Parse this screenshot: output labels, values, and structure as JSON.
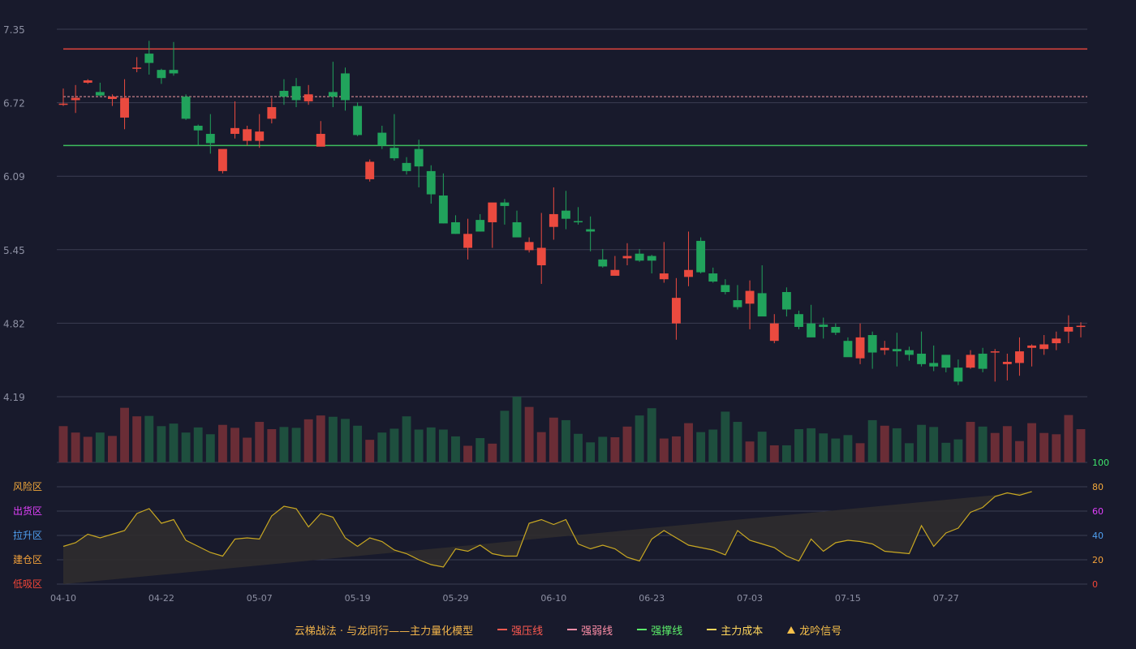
{
  "chart_data": {
    "type": "candlestick",
    "dates": [
      "04-10",
      "04-11",
      "04-14",
      "04-15",
      "04-16",
      "04-17",
      "04-18",
      "04-21",
      "04-22",
      "04-23",
      "04-24",
      "04-25",
      "04-28",
      "04-29",
      "04-30",
      "05-01",
      "05-02",
      "05-05",
      "05-06",
      "05-07",
      "05-08",
      "05-09",
      "05-12",
      "05-13",
      "05-14",
      "05-15",
      "05-16",
      "05-19",
      "05-20",
      "05-21",
      "05-22",
      "05-23",
      "05-26",
      "05-27",
      "05-28",
      "05-29",
      "05-30",
      "06-02",
      "06-03",
      "06-04",
      "06-05",
      "06-06",
      "06-09",
      "06-10",
      "06-11",
      "06-12",
      "06-13",
      "06-16",
      "06-17",
      "06-18",
      "06-19",
      "06-20",
      "06-23",
      "06-24",
      "06-25",
      "06-26",
      "06-27",
      "06-30",
      "07-01",
      "07-02",
      "07-03",
      "07-04",
      "07-07",
      "07-08",
      "07-09",
      "07-10",
      "07-11",
      "07-14",
      "07-15",
      "07-16",
      "07-17",
      "07-18",
      "07-21",
      "07-22",
      "07-23",
      "07-24",
      "07-25",
      "07-28",
      "07-29",
      "07-30",
      "07-31",
      "08-01",
      "08-04",
      "08-05"
    ],
    "x_tick_labels": [
      "04-10",
      "04-22",
      "05-07",
      "05-19",
      "05-29",
      "06-10",
      "06-23",
      "07-03",
      "07-15",
      "07-27"
    ],
    "x_tick_indices": [
      0,
      8,
      16,
      24,
      32,
      40,
      48,
      56,
      64,
      72
    ],
    "open": [
      6.7,
      6.74,
      6.89,
      6.81,
      6.75,
      6.59,
      7.01,
      7.14,
      7.0,
      7.0,
      6.77,
      6.52,
      6.45,
      6.13,
      6.45,
      6.39,
      6.39,
      6.58,
      6.82,
      6.86,
      6.73,
      6.34,
      6.81,
      6.97,
      6.69,
      6.06,
      6.46,
      6.33,
      6.2,
      6.32,
      6.13,
      5.92,
      5.69,
      5.47,
      5.71,
      5.69,
      5.86,
      5.69,
      5.45,
      5.32,
      5.65,
      5.79,
      5.7,
      5.63,
      5.37,
      5.23,
      5.38,
      5.42,
      5.4,
      5.2,
      4.82,
      5.22,
      5.53,
      5.25,
      5.15,
      5.02,
      4.99,
      5.08,
      4.67,
      5.09,
      4.9,
      4.82,
      4.81,
      4.79,
      4.67,
      4.52,
      4.72,
      4.59,
      4.6,
      4.59,
      4.56,
      4.48,
      4.55,
      4.44,
      4.44,
      4.56,
      4.58,
      4.47,
      4.48,
      4.61,
      4.6,
      4.65,
      4.75,
      4.79
    ],
    "close": [
      6.71,
      6.76,
      6.91,
      6.78,
      6.77,
      6.76,
      7.02,
      7.06,
      6.93,
      6.97,
      6.58,
      6.48,
      6.37,
      6.32,
      6.5,
      6.49,
      6.47,
      6.68,
      6.77,
      6.74,
      6.79,
      6.45,
      6.77,
      6.74,
      6.44,
      6.21,
      6.35,
      6.24,
      6.13,
      6.17,
      5.93,
      5.68,
      5.59,
      5.59,
      5.61,
      5.86,
      5.83,
      5.56,
      5.52,
      5.47,
      5.76,
      5.72,
      5.69,
      5.61,
      5.31,
      5.28,
      5.4,
      5.36,
      5.36,
      5.25,
      5.04,
      5.28,
      5.26,
      5.18,
      5.09,
      4.96,
      5.1,
      4.88,
      4.82,
      4.94,
      4.79,
      4.7,
      4.79,
      4.74,
      4.53,
      4.7,
      4.57,
      4.61,
      4.58,
      4.55,
      4.47,
      4.45,
      4.44,
      4.32,
      4.55,
      4.43,
      4.58,
      4.49,
      4.58,
      4.63,
      4.64,
      4.69,
      4.79,
      4.8
    ],
    "high": [
      6.84,
      6.87,
      6.92,
      6.89,
      6.79,
      6.92,
      7.11,
      7.25,
      7.01,
      7.24,
      6.79,
      6.53,
      6.62,
      6.3,
      6.73,
      6.52,
      6.62,
      6.76,
      6.92,
      6.93,
      6.87,
      6.56,
      7.07,
      7.02,
      6.72,
      6.23,
      6.52,
      6.62,
      6.25,
      6.4,
      6.18,
      6.11,
      5.75,
      5.72,
      5.76,
      5.85,
      5.89,
      5.79,
      5.56,
      5.77,
      5.99,
      5.96,
      5.82,
      5.74,
      5.46,
      5.4,
      5.51,
      5.46,
      5.41,
      5.52,
      5.21,
      5.61,
      5.56,
      5.3,
      5.2,
      5.15,
      5.19,
      5.32,
      4.9,
      5.13,
      4.93,
      4.98,
      4.87,
      4.82,
      4.7,
      4.82,
      4.75,
      4.67,
      4.74,
      4.62,
      4.75,
      4.63,
      4.55,
      4.51,
      4.59,
      4.61,
      4.6,
      4.56,
      4.7,
      4.64,
      4.72,
      4.75,
      4.89,
      4.83
    ],
    "low": [
      6.69,
      6.63,
      6.88,
      6.77,
      6.69,
      6.49,
      6.98,
      6.96,
      6.88,
      6.95,
      6.57,
      6.35,
      6.28,
      6.11,
      6.41,
      6.35,
      6.33,
      6.54,
      6.7,
      6.68,
      6.7,
      6.35,
      6.68,
      6.65,
      6.43,
      6.04,
      6.32,
      6.22,
      6.1,
      5.99,
      5.85,
      5.68,
      5.59,
      5.37,
      5.61,
      5.47,
      5.67,
      5.58,
      5.43,
      5.16,
      5.54,
      5.63,
      5.67,
      5.44,
      5.3,
      5.26,
      5.32,
      5.35,
      5.25,
      5.17,
      4.68,
      5.14,
      5.25,
      5.17,
      5.07,
      4.94,
      4.77,
      4.9,
      4.65,
      4.88,
      4.77,
      4.77,
      4.69,
      4.72,
      4.55,
      4.47,
      4.43,
      4.55,
      4.45,
      4.5,
      4.45,
      4.41,
      4.4,
      4.29,
      4.43,
      4.4,
      4.32,
      4.33,
      4.37,
      4.45,
      4.55,
      4.59,
      4.65,
      4.7
    ],
    "volume": [
      0.85,
      0.7,
      0.6,
      0.7,
      0.62,
      1.28,
      1.08,
      1.09,
      0.85,
      0.91,
      0.7,
      0.82,
      0.66,
      0.88,
      0.81,
      0.58,
      0.95,
      0.78,
      0.83,
      0.81,
      1.01,
      1.1,
      1.07,
      1.02,
      0.86,
      0.53,
      0.7,
      0.79,
      1.08,
      0.77,
      0.82,
      0.77,
      0.61,
      0.39,
      0.57,
      0.44,
      1.21,
      1.54,
      1.3,
      0.71,
      1.05,
      0.99,
      0.67,
      0.47,
      0.6,
      0.59,
      0.84,
      1.1,
      1.27,
      0.56,
      0.61,
      0.92,
      0.71,
      0.77,
      1.19,
      0.95,
      0.49,
      0.72,
      0.4,
      0.4,
      0.78,
      0.8,
      0.68,
      0.56,
      0.64,
      0.45,
      0.99,
      0.86,
      0.8,
      0.45,
      0.88,
      0.83,
      0.46,
      0.54,
      0.95,
      0.84,
      0.69,
      0.85,
      0.5,
      0.92,
      0.69,
      0.66,
      1.11,
      0.78
    ],
    "indicator": [
      31,
      34,
      41,
      38,
      41,
      44,
      58,
      62,
      50,
      53,
      36,
      31,
      26,
      23,
      37,
      38,
      37,
      56,
      64,
      62,
      47,
      58,
      55,
      38,
      31,
      38,
      35,
      28,
      25,
      20,
      16,
      14,
      29,
      27,
      32,
      25,
      23,
      23,
      50,
      53,
      49,
      53,
      33,
      29,
      32,
      29,
      22,
      19,
      37,
      44,
      38,
      32,
      30,
      28,
      24,
      44,
      36,
      33,
      30,
      23,
      19,
      37,
      27,
      34,
      36,
      35,
      33,
      27,
      26,
      25,
      48,
      31,
      42,
      46,
      59,
      63,
      72,
      75,
      73,
      76
    ],
    "price_axis": {
      "min": 4.19,
      "max": 7.35,
      "ticks": [
        "7.35",
        "6.72",
        "6.09",
        "5.45",
        "4.82",
        "4.19"
      ]
    },
    "indicator_axis": {
      "min": 0,
      "max": 100,
      "ticks": [
        "100",
        "80",
        "60",
        "40",
        "20",
        "0"
      ],
      "tick_colors": [
        "#3ee46b",
        "#f2a83b",
        "#e040fb",
        "#4f9ff0",
        "#f3a13a",
        "#f24638"
      ]
    },
    "zone_labels": [
      {
        "label": "风险区",
        "color": "#f2a83b"
      },
      {
        "label": "出货区",
        "color": "#e040fb"
      },
      {
        "label": "拉升区",
        "color": "#4f9ff0"
      },
      {
        "label": "建仓区",
        "color": "#f3a13a"
      },
      {
        "label": "低吸区",
        "color": "#f24638"
      }
    ],
    "lines": {
      "pressure": {
        "value": 7.18,
        "color": "#e3453d"
      },
      "weak": {
        "value": 6.77,
        "color": "#f29aa0"
      },
      "support": {
        "value": 6.35,
        "color": "#3dbd5c"
      }
    },
    "colors": {
      "up": "#ea4a3f",
      "down": "#21a35c",
      "vol_up": "#6a2d36",
      "vol_down": "#1e4f3e",
      "grid": "#3a3d52",
      "axis_text": "#8d90a3",
      "indicator_line": "#c9a822",
      "indicator_fill": "#2f2c2d"
    },
    "legend": [
      {
        "label": "云梯战法 · 与龙同行——主力量化模型",
        "color": "#f2b44a",
        "swatch": "none"
      },
      {
        "label": "强压线",
        "color": "#ff5a50",
        "swatch": "line"
      },
      {
        "label": "强弱线",
        "color": "#ff8fa8",
        "swatch": "dash"
      },
      {
        "label": "强撑线",
        "color": "#5cf06a",
        "swatch": "line"
      },
      {
        "label": "主力成本",
        "color": "#ffd65c",
        "swatch": "dash"
      },
      {
        "label": "龙吟信号",
        "color": "#f7c04a",
        "swatch": "triangle"
      }
    ]
  }
}
